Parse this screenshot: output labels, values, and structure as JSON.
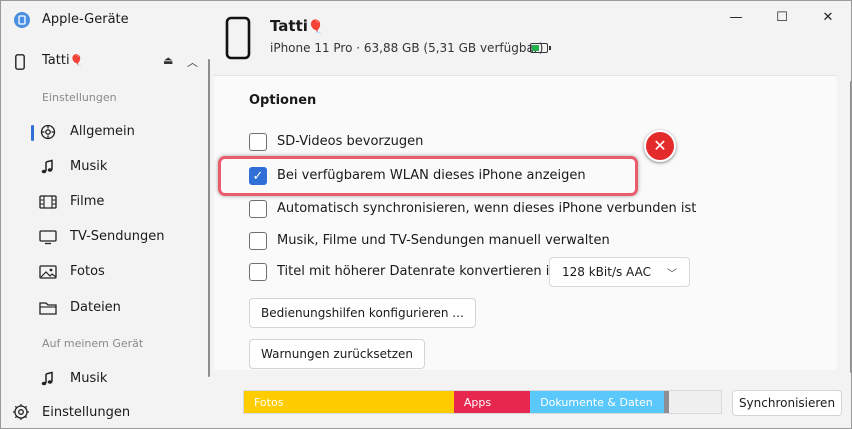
{
  "app": {
    "title": "Apple-Geräte"
  },
  "device": {
    "name": "Tatti",
    "name_emoji": "🎈",
    "info": "iPhone 11 Pro · 63,88 GB (5,31 GB verfügbar)",
    "battery_level": 0.5
  },
  "sidebar": {
    "section_settings": "Einstellungen",
    "items": [
      {
        "label": "Allgemein",
        "icon": "gear-icon",
        "active": true
      },
      {
        "label": "Musik",
        "icon": "music-note-icon"
      },
      {
        "label": "Filme",
        "icon": "film-icon"
      },
      {
        "label": "TV-Sendungen",
        "icon": "tv-icon"
      },
      {
        "label": "Fotos",
        "icon": "photo-icon"
      },
      {
        "label": "Dateien",
        "icon": "folder-icon"
      }
    ],
    "section_device": "Auf meinem Gerät",
    "device_items": [
      {
        "label": "Musik",
        "icon": "music-note-icon"
      }
    ],
    "settings_label": "Einstellungen"
  },
  "window_controls": {
    "minimize": "—",
    "maximize": "☐",
    "close": "✕"
  },
  "options": {
    "title": "Optionen",
    "items": [
      {
        "label": "SD-Videos bevorzugen",
        "checked": false
      },
      {
        "label": "Bei verfügbarem WLAN dieses iPhone anzeigen",
        "checked": true
      },
      {
        "label": "Automatisch synchronisieren, wenn dieses iPhone verbunden ist",
        "checked": false
      },
      {
        "label": "Musik, Filme und TV-Sendungen manuell verwalten",
        "checked": false
      },
      {
        "label": "Titel mit höherer Datenrate konvertieren in",
        "checked": false
      }
    ],
    "bitrate_select": {
      "value": "128 kBit/s AAC"
    },
    "accessibility_button": "Bedienungshilfen konfigurieren ...",
    "reset_warnings_button": "Warnungen zurücksetzen"
  },
  "annotation": {
    "error_mark": "✕",
    "highlight_color": "#e85c6c"
  },
  "storage": {
    "segments": [
      {
        "label": "Fotos",
        "color": "#ffcc00",
        "fraction": 0.44
      },
      {
        "label": "Apps",
        "color": "#e8274f",
        "fraction": 0.16
      },
      {
        "label": "Dokumente & Daten",
        "color": "#5ac8fa",
        "fraction": 0.28
      },
      {
        "label": "",
        "color": "#8e8e93",
        "fraction": 0.01
      }
    ]
  },
  "sync_button": "Synchronisieren",
  "colors": {
    "accent": "#2f6fd6"
  }
}
